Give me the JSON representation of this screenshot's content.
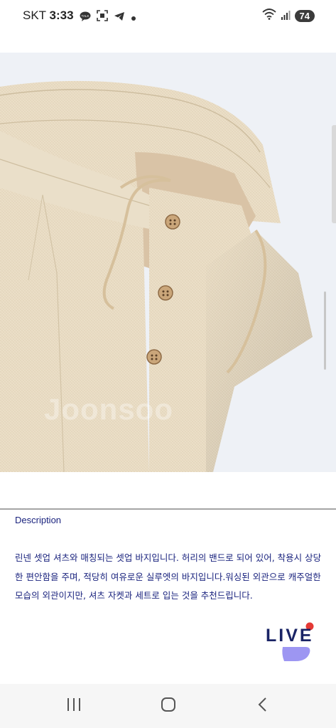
{
  "status_bar": {
    "carrier": "SKT",
    "time": "3:33",
    "battery": "74",
    "icons_left": [
      "talk-icon",
      "screenshot-icon",
      "telegram-icon",
      "dot-icon"
    ],
    "icons_right": [
      "wifi-icon",
      "signal-icon",
      "battery-icon"
    ]
  },
  "product": {
    "image": "beige-linen-pants-photo",
    "watermark": "Joonsoo"
  },
  "description": {
    "title": "Description",
    "lines": [
      "린넨 셋업 셔츠와 매칭되는 셋업 바지입니다. 허리의 밴드로 되어 있어, 착용시 상당",
      "한 편안함을 주며, 적당히 여유로운 실루엣의 바지입니다.워싱된 외관으로 캐주얼한",
      "모습의 외관이지만, 셔츠 자켓과 세트로 입는 것을 추천드립니다."
    ]
  },
  "live_badge": {
    "label": "LIVE",
    "colors": {
      "text": "#1a2466",
      "dot": "#e53935",
      "bubble": "#8c84f0"
    }
  },
  "nav_bar": {
    "items": [
      "recents-icon",
      "home-icon",
      "back-icon"
    ]
  }
}
